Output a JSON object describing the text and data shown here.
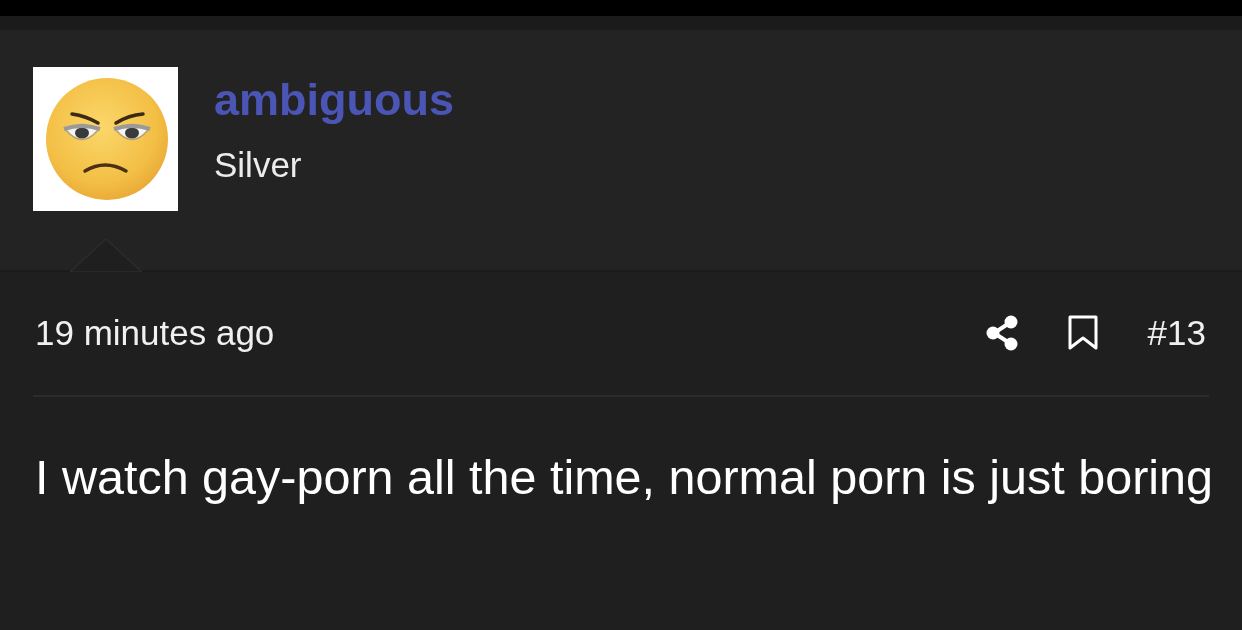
{
  "post": {
    "author": {
      "name": "ambiguous",
      "rank": "Silver"
    },
    "time": "19 minutes ago",
    "number": "#13",
    "body": "I watch gay-porn all the time, normal porn is just boring"
  }
}
